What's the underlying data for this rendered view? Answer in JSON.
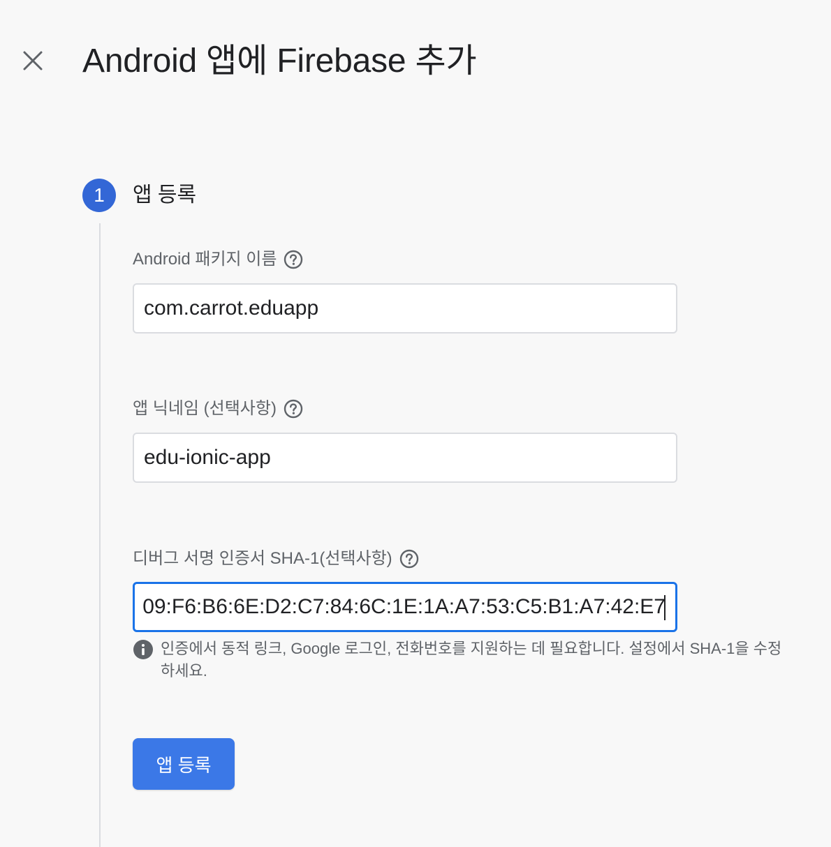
{
  "dialog": {
    "title": "Android 앱에 Firebase 추가",
    "close_icon": "close-icon"
  },
  "step": {
    "number": "1",
    "title": "앱 등록"
  },
  "fields": {
    "package_name": {
      "label": "Android 패키지 이름",
      "value": "com.carrot.eduapp",
      "help_icon": "help-circle-icon"
    },
    "nickname": {
      "label": "앱 닉네임 (선택사항)",
      "value": "edu-ionic-app",
      "help_icon": "help-circle-icon"
    },
    "sha1": {
      "label": "디버그 서명 인증서 SHA-1(선택사항)",
      "value": "09:F6:B6:6E:D2:C7:84:6C:1E:1A:A7:53:C5:B1:A7:42:E7",
      "help_icon": "help-circle-icon"
    }
  },
  "info": {
    "icon": "info-icon",
    "text": "인증에서 동적 링크, Google 로그인, 전화번호를 지원하는 데 필요합니다. 설정에서 SHA-1을 수정하세요."
  },
  "actions": {
    "register_label": "앱 등록"
  },
  "colors": {
    "accent": "#3b78e7",
    "focus_border": "#1a73e8",
    "background": "#f8f8f8"
  }
}
